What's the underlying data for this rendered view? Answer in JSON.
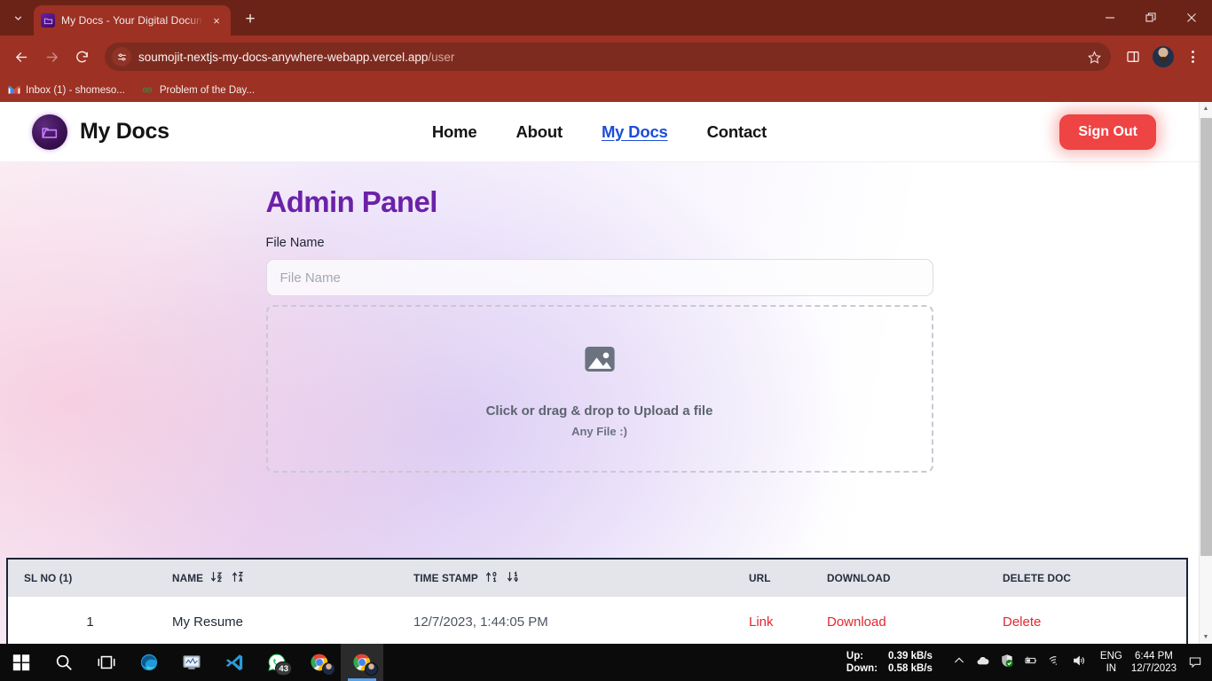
{
  "browser": {
    "tab": {
      "title": "My Docs - Your Digital Docume",
      "favicon": "folder-icon",
      "close": "×"
    },
    "new_tab_label": "+",
    "window_controls": {
      "minimize": "minimize-icon",
      "restore": "restore-icon",
      "close": "close-icon"
    },
    "nav": {
      "back": "back-arrow-icon",
      "forward": "forward-arrow-icon",
      "reload": "reload-icon"
    },
    "omnibox": {
      "site_settings_icon": "tune-icon",
      "url_domain": "soumojit-nextjs-my-docs-anywhere-webapp.vercel.app",
      "url_path": "/user",
      "bookmark_icon": "star-icon"
    },
    "toolbar": {
      "side_panel_icon": "side-panel-icon",
      "profile_icon": "profile-avatar",
      "menu_icon": "three-dots-icon"
    },
    "bookmarks": [
      {
        "label": "Inbox (1) - shomeso...",
        "icon": "gmail-icon"
      },
      {
        "label": "Problem of the Day...",
        "icon": "geeksforgeeks-icon"
      }
    ]
  },
  "site": {
    "brand": {
      "name": "My Docs",
      "logo_icon": "folder-logo-icon"
    },
    "nav_links": [
      {
        "label": "Home",
        "active": false
      },
      {
        "label": "About",
        "active": false
      },
      {
        "label": "My Docs",
        "active": true
      },
      {
        "label": "Contact",
        "active": false
      }
    ],
    "sign_out_label": "Sign Out",
    "accent_purple": "#6b21a8",
    "accent_red": "#ef4444",
    "link_red": "#e8262c"
  },
  "panel": {
    "title": "Admin Panel",
    "file_name_label": "File Name",
    "file_name_value": "",
    "file_name_placeholder": "File Name",
    "dropzone": {
      "icon": "image-placeholder-icon",
      "main_text": "Click or drag & drop to Upload a file",
      "sub_text": "Any File :)"
    }
  },
  "table": {
    "columns": [
      {
        "label": "SL NO (1)",
        "sort_icons": []
      },
      {
        "label": "NAME",
        "sort_icons": [
          "arrow-down-a-z-icon",
          "arrow-up-z-a-icon"
        ]
      },
      {
        "label": "TIME STAMP",
        "sort_icons": [
          "arrow-up-0-1-icon",
          "arrow-down-1-9-icon"
        ]
      },
      {
        "label": "URL",
        "sort_icons": []
      },
      {
        "label": "DOWNLOAD",
        "sort_icons": []
      },
      {
        "label": "DELETE DOC",
        "sort_icons": []
      }
    ],
    "rows": [
      {
        "sl_no": "1",
        "name": "My Resume",
        "time_stamp": "12/7/2023, 1:44:05 PM",
        "url_label": "Link",
        "download_label": "Download",
        "delete_label": "Delete"
      }
    ]
  },
  "taskbar": {
    "items": [
      {
        "name": "start-button",
        "icon": "windows-icon"
      },
      {
        "name": "search-button",
        "icon": "search-icon"
      },
      {
        "name": "task-view-button",
        "icon": "task-view-icon"
      },
      {
        "name": "edge-button",
        "icon": "edge-icon"
      },
      {
        "name": "system-monitor-button",
        "icon": "monitor-icon"
      },
      {
        "name": "vscode-button",
        "icon": "vscode-icon"
      },
      {
        "name": "whatsapp-button",
        "icon": "whatsapp-icon",
        "badge": "43"
      },
      {
        "name": "chrome-button",
        "icon": "chrome-icon"
      },
      {
        "name": "chrome-active-button",
        "icon": "chrome-icon",
        "active": true
      }
    ],
    "network": {
      "up_label": "Up:",
      "up_value": "0.39 kB/s",
      "down_label": "Down:",
      "down_value": "0.58 kB/s"
    },
    "tray_icons": [
      "chevron-up-icon",
      "onedrive-cloud-icon",
      "windows-security-shield-icon",
      "battery-icon",
      "wifi-icon",
      "volume-icon"
    ],
    "language": {
      "line1": "ENG",
      "line2": "IN"
    },
    "clock": {
      "time": "6:44 PM",
      "date": "12/7/2023"
    },
    "notification_icon": "notification-icon"
  }
}
